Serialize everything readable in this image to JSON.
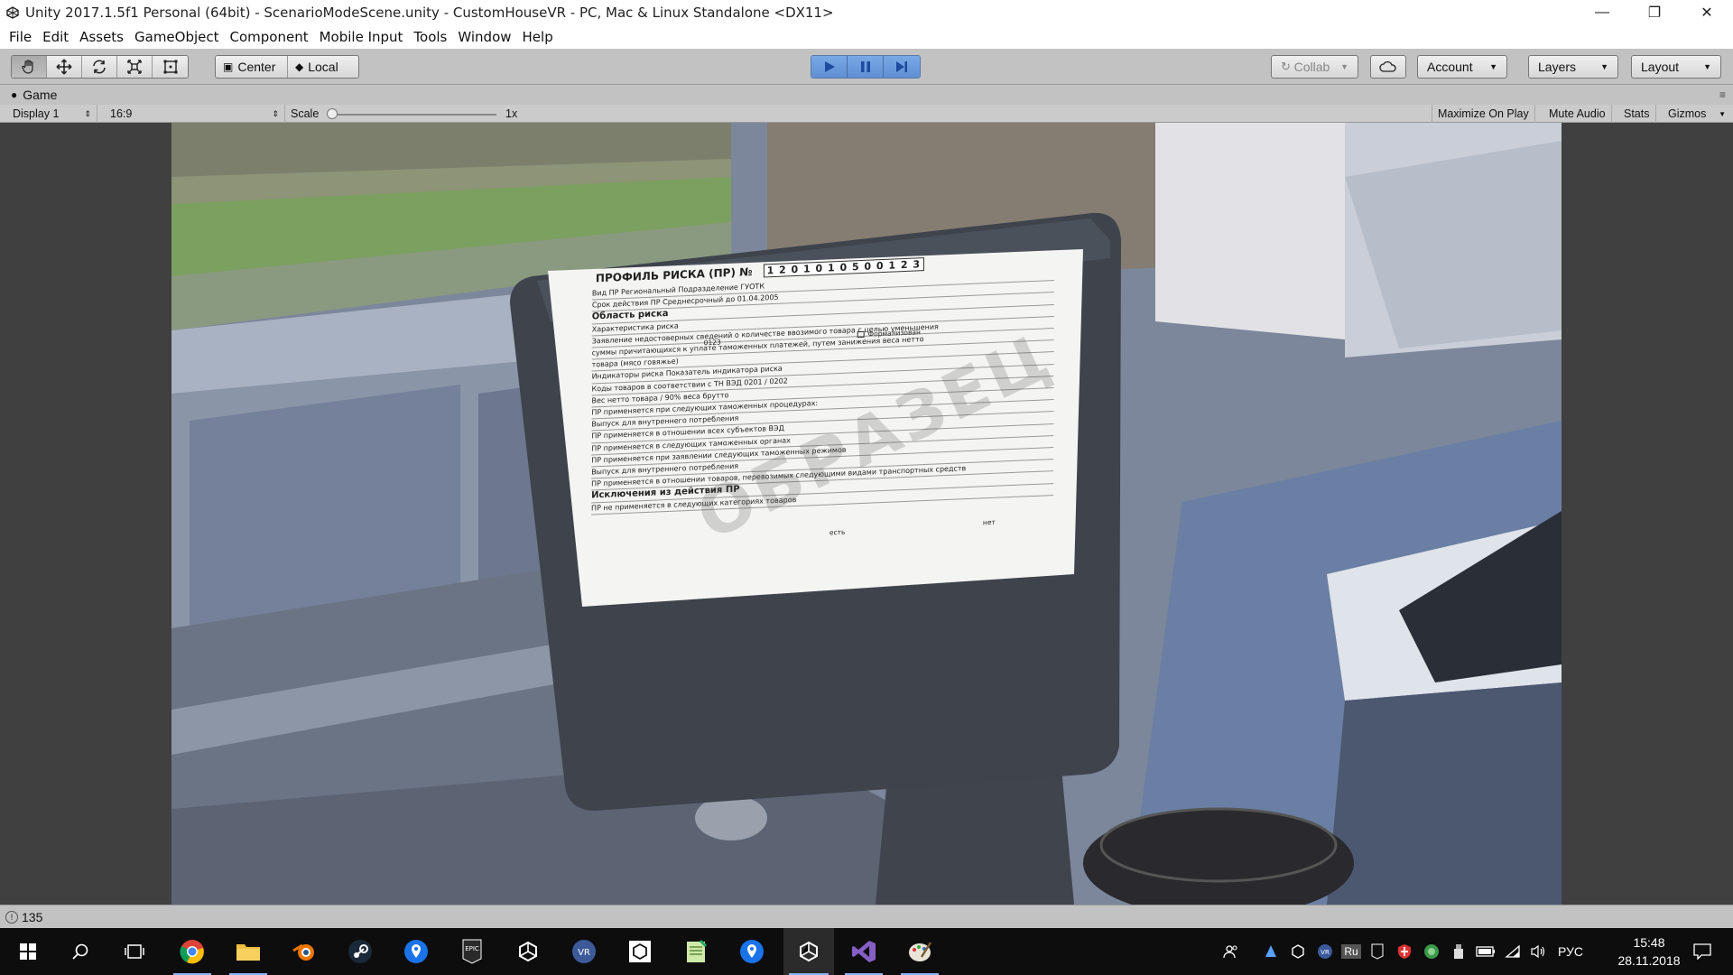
{
  "window": {
    "title": "Unity 2017.1.5f1 Personal (64bit) - ScenarioModeScene.unity - CustomHouseVR - PC, Mac & Linux Standalone <DX11>",
    "controls": [
      "minimize",
      "restore",
      "close"
    ]
  },
  "menu": [
    "File",
    "Edit",
    "Assets",
    "GameObject",
    "Component",
    "Mobile Input",
    "Tools",
    "Window",
    "Help"
  ],
  "toolbar": {
    "tools": [
      "hand-tool",
      "move-tool",
      "rotate-tool",
      "scale-tool",
      "rect-tool"
    ],
    "pivot_label": "Center",
    "space_label": "Local",
    "collab_label": "Collab",
    "account_label": "Account",
    "layers_label": "Layers",
    "layout_label": "Layout"
  },
  "game_tab": {
    "label": "Game"
  },
  "game_bar": {
    "display": "Display 1",
    "aspect": "16:9",
    "scale_label": "Scale",
    "scale_value": "1x",
    "scale_fraction": 0.0,
    "maximize": "Maximize On Play",
    "mute": "Mute Audio",
    "stats": "Stats",
    "gizmos": "Gizmos"
  },
  "document": {
    "title": "ПРОФИЛЬ РИСКА (ПР) №",
    "number": "1 2   0 1 0 1 0 5   0 0 1 2 3",
    "lines": [
      "Вид ПР   Региональный        Подразделение   ГУОТК",
      "Срок действия ПР   Среднесрочный    до  01.04.2005",
      "Область риска",
      "Характеристика риска",
      "Заявление недостоверных сведений о количестве ввозимого товара с целью уменьшения",
      "суммы причитающихся к уплате таможенных платежей, путем занижения веса нетто",
      "товара (мясо говяжье)",
      "Индикаторы риска                     Показатель индикатора риска",
      "Коды товаров в соответствии с ТН ВЭД           0201 / 0202",
      "Вес нетто товара                               / 90% веса брутто",
      "ПР применяется при следующих таможенных процедурах:",
      "Выпуск для внутреннего потребления",
      "ПР применяется в отношении всех субъектов ВЭД",
      "ПР применяется в следующих таможенных органах",
      "ПР применяется при заявлении следующих таможенных режимов",
      "Выпуск для внутреннего потребления",
      "ПР применяется в отношении товаров, перевозимых следующими видами транспортных средств",
      "Исключения из действия ПР",
      "ПР не применяется в следующих категориях товаров"
    ],
    "stamp": "ОБРАЗЕЦ",
    "formalized_label": "Формализован",
    "code_label": "0123",
    "yes_label": "есть",
    "no_label": "нет"
  },
  "status": {
    "count": "135"
  },
  "taskbar": {
    "apps": [
      "windows-start",
      "search",
      "task-view",
      "chrome",
      "file-explorer",
      "blender",
      "steam",
      "maps-pin",
      "epic-games",
      "unity",
      "vr-app",
      "unity-hub",
      "notepad",
      "maps-pin-2",
      "unity-editor",
      "visual-studio",
      "paint"
    ],
    "tray_lang": "РУС",
    "tray_ime": "Ru",
    "time": "15:48",
    "date": "28.11.2018"
  }
}
